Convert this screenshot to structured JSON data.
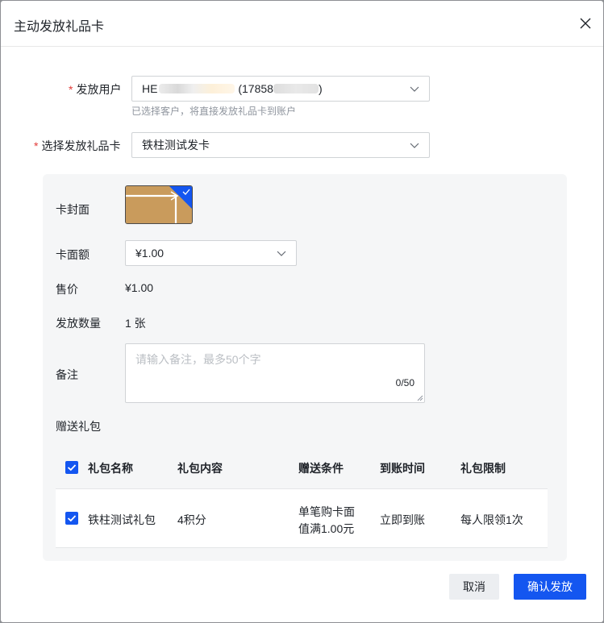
{
  "dialog": {
    "title": "主动发放礼品卡",
    "close_icon": "close-icon"
  },
  "form": {
    "user_label": "发放用户",
    "user_value_prefix": "HE",
    "user_value_phone": "(17858",
    "user_value_suffix": ")",
    "user_hint": "已选择客户，将直接发放礼品卡到账户",
    "card_label": "选择发放礼品卡",
    "card_value": "铁柱测试发卡",
    "required_mark": "*"
  },
  "card": {
    "cover_label": "卡封面",
    "face_value_label": "卡面额",
    "face_value": "¥1.00",
    "price_label": "售价",
    "price": "¥1.00",
    "quantity_label": "发放数量",
    "quantity": "1 张",
    "remark_label": "备注",
    "remark_placeholder": "请输入备注，最多50个字",
    "remark_count": "0/50",
    "gift_label": "赠送礼包"
  },
  "gift_table": {
    "headers": [
      "礼包名称",
      "礼包内容",
      "赠送条件",
      "到账时间",
      "礼包限制"
    ],
    "rows": [
      {
        "name": "铁柱测试礼包",
        "content": "4积分",
        "condition_line1": "单笔购卡面",
        "condition_line2": "值满1.00元",
        "arrival": "立即到账",
        "limit": "每人限领1次",
        "checked": true
      }
    ],
    "all_checked": true
  },
  "footer": {
    "cancel_label": "取消",
    "confirm_label": "确认发放"
  },
  "colors": {
    "primary": "#1456f0",
    "required": "#e23c39",
    "cover": "#c99b5c"
  }
}
